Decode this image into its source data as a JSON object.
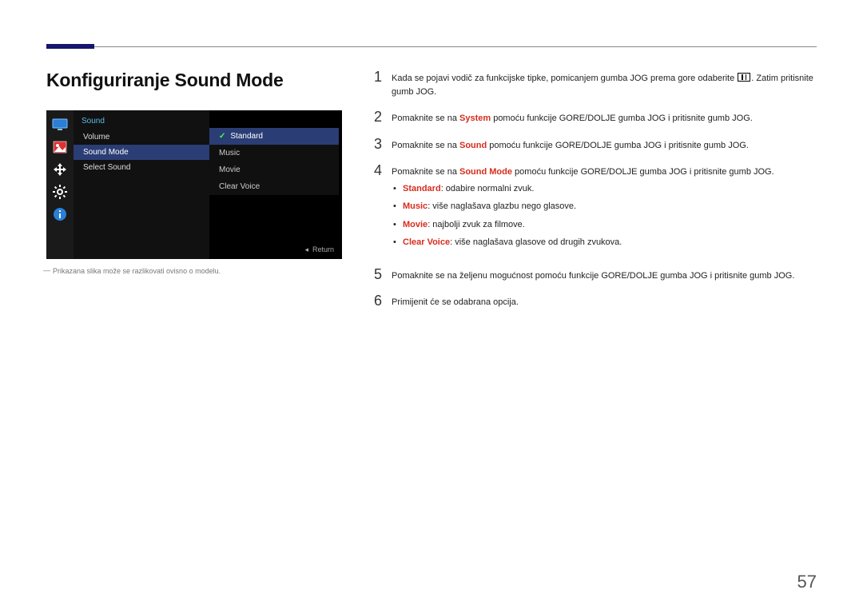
{
  "heading": "Konfiguriranje Sound Mode",
  "osd": {
    "title": "Sound",
    "rows": [
      "Volume",
      "Sound Mode",
      "Select Sound"
    ],
    "selected_row": "Sound Mode",
    "sub": [
      "Standard",
      "Music",
      "Movie",
      "Clear Voice"
    ],
    "sub_selected": "Standard",
    "return": "Return"
  },
  "note": "Prikazana slika može se razlikovati ovisno o modelu.",
  "steps": {
    "s1a": "Kada se pojavi vodič za funkcijske tipke, pomicanjem gumba JOG prema gore odaberite ",
    "s1b": ". Zatim pritisnite gumb JOG.",
    "s2a": "Pomaknite se na ",
    "s2b": " pomoću funkcije GORE/DOLJE gumba JOG i pritisnite gumb JOG.",
    "s2k": "System",
    "s3k": "Sound",
    "s4k": "Sound Mode",
    "bul": {
      "standard_k": "Standard",
      "standard_v": ": odabire normalni zvuk.",
      "music_k": "Music",
      "music_v": ": više naglašava glazbu nego glasove.",
      "movie_k": "Movie",
      "movie_v": ": najbolji zvuk za filmove.",
      "clear_k": "Clear Voice",
      "clear_v": ": više naglašava glasove od drugih zvukova."
    },
    "s5": "Pomaknite se na željenu mogućnost pomoću funkcije GORE/DOLJE gumba JOG i pritisnite gumb JOG.",
    "s6": "Primijenit će se odabrana opcija."
  },
  "pageno": "57"
}
